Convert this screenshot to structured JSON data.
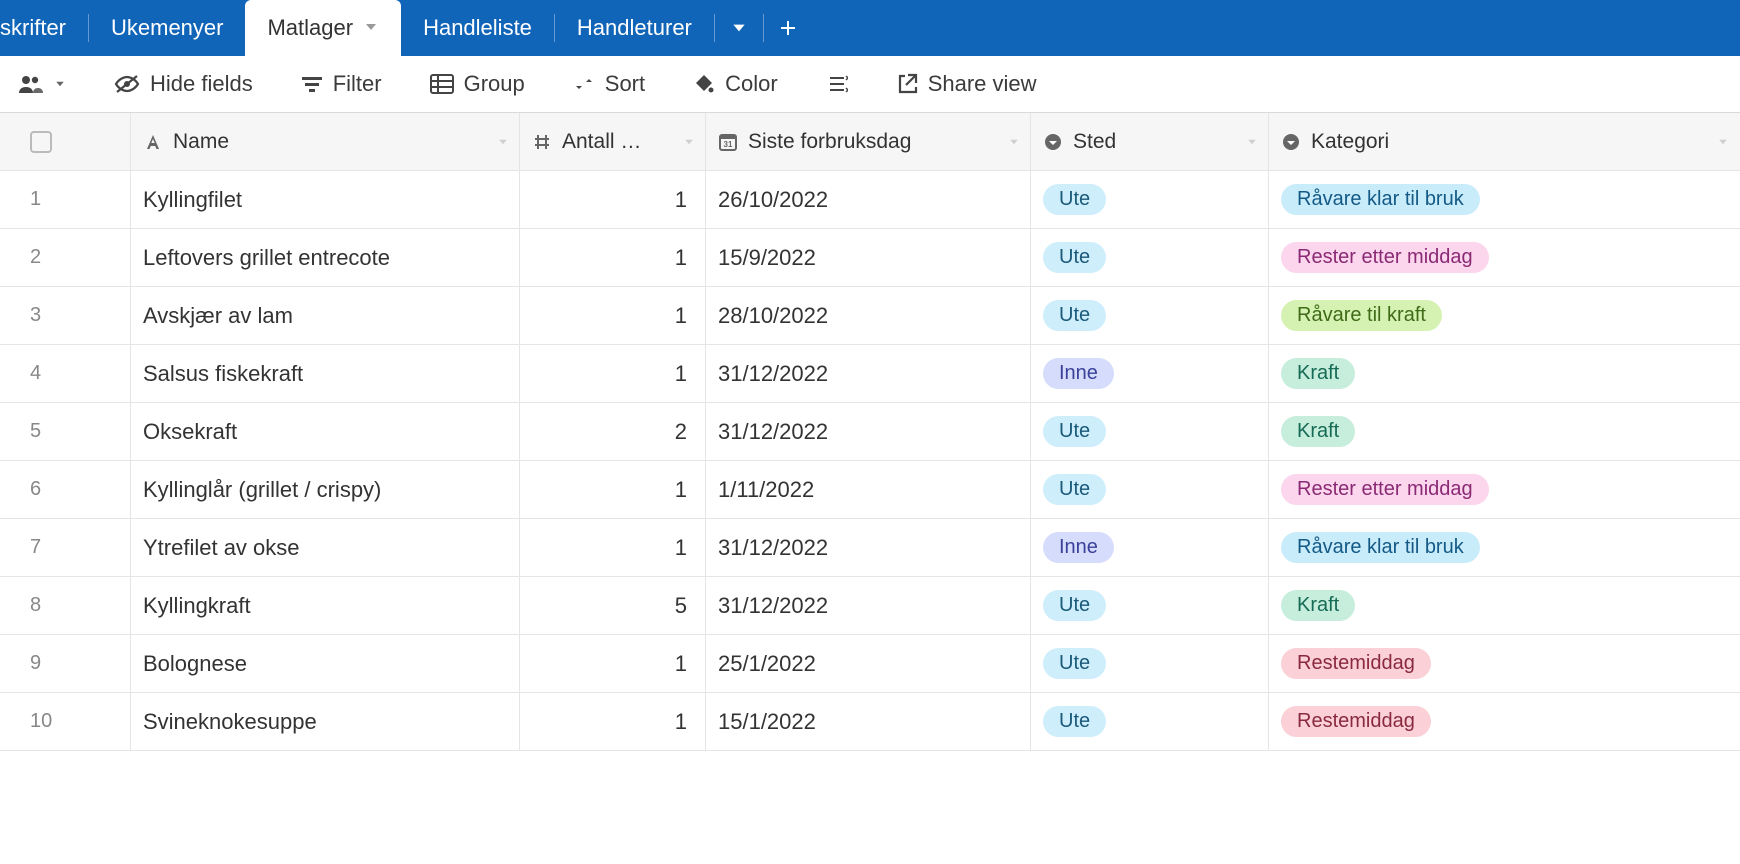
{
  "tabs": [
    {
      "label": "skrifter",
      "truncated": true
    },
    {
      "label": "Ukemenyer"
    },
    {
      "label": "Matlager",
      "active": true,
      "chevron": true
    },
    {
      "label": "Handleliste"
    },
    {
      "label": "Handleturer"
    }
  ],
  "toolbar": {
    "hide_fields": "Hide fields",
    "filter": "Filter",
    "group": "Group",
    "sort": "Sort",
    "color": "Color",
    "share": "Share view"
  },
  "columns": {
    "name": "Name",
    "antall": "Antall …",
    "siste": "Siste forbruksdag",
    "sted": "Sted",
    "kategori": "Kategori"
  },
  "sted_colors": {
    "Ute": "ute",
    "Inne": "inne"
  },
  "kategori_colors": {
    "Råvare klar til bruk": "raavare-klar",
    "Rester etter middag": "rester",
    "Råvare til kraft": "raavare-kraft",
    "Kraft": "kraft",
    "Restemiddag": "restemiddag"
  },
  "rows": [
    {
      "n": "1",
      "name": "Kyllingfilet",
      "antall": "1",
      "date": "26/10/2022",
      "sted": "Ute",
      "kat": "Råvare klar til bruk"
    },
    {
      "n": "2",
      "name": "Leftovers grillet entrecote",
      "antall": "1",
      "date": "15/9/2022",
      "sted": "Ute",
      "kat": "Rester etter middag"
    },
    {
      "n": "3",
      "name": "Avskjær av lam",
      "antall": "1",
      "date": "28/10/2022",
      "sted": "Ute",
      "kat": "Råvare til kraft"
    },
    {
      "n": "4",
      "name": "Salsus fiskekraft",
      "antall": "1",
      "date": "31/12/2022",
      "sted": "Inne",
      "kat": "Kraft"
    },
    {
      "n": "5",
      "name": "Oksekraft",
      "antall": "2",
      "date": "31/12/2022",
      "sted": "Ute",
      "kat": "Kraft"
    },
    {
      "n": "6",
      "name": "Kyllinglår (grillet / crispy)",
      "antall": "1",
      "date": "1/11/2022",
      "sted": "Ute",
      "kat": "Rester etter middag"
    },
    {
      "n": "7",
      "name": "Ytrefilet av okse",
      "antall": "1",
      "date": "31/12/2022",
      "sted": "Inne",
      "kat": "Råvare klar til bruk"
    },
    {
      "n": "8",
      "name": "Kyllingkraft",
      "antall": "5",
      "date": "31/12/2022",
      "sted": "Ute",
      "kat": "Kraft"
    },
    {
      "n": "9",
      "name": "Bolognese",
      "antall": "1",
      "date": "25/1/2022",
      "sted": "Ute",
      "kat": "Restemiddag"
    },
    {
      "n": "10",
      "name": "Svineknokesuppe",
      "antall": "1",
      "date": "15/1/2022",
      "sted": "Ute",
      "kat": "Restemiddag"
    }
  ]
}
